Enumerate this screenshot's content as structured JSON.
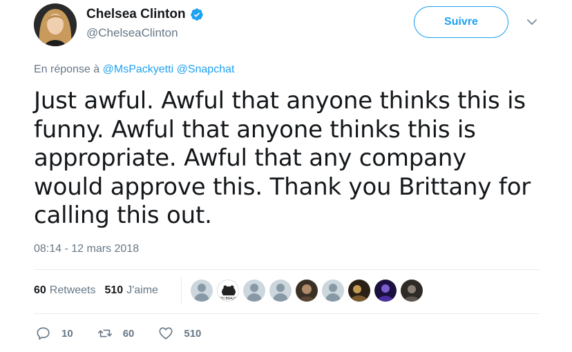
{
  "author": {
    "name": "Chelsea Clinton",
    "handle": "@ChelseaClinton",
    "verified": true,
    "avatar_icon": "profile-photo"
  },
  "header": {
    "follow_label": "Suivre",
    "more_icon": "chevron-down-icon"
  },
  "reply": {
    "prefix": "En réponse à",
    "mentions": [
      "@MsPackyetti",
      "@Snapchat"
    ]
  },
  "tweet": {
    "text": "Just awful. Awful that anyone thinks this is funny. Awful that anyone thinks this is appropriate. Awful that any company would approve this. Thank you Brittany for calling this out.",
    "timestamp": "08:14 - 12 mars 2018"
  },
  "stats": {
    "retweets_count": "60",
    "retweets_label": "Retweets",
    "likes_count": "510",
    "likes_label": "J'aime"
  },
  "liker_avatars": [
    "default",
    "idibrau-logo",
    "default",
    "default",
    "photo-dark",
    "default",
    "photo-warm",
    "photo-purple",
    "photo-grey"
  ],
  "liker_logo_text": "IDI BRAUN",
  "actions": {
    "reply_count": "10",
    "retweet_count": "60",
    "like_count": "510"
  },
  "colors": {
    "accent": "#1da1f2",
    "muted": "#657786",
    "text": "#14171a",
    "divider": "#e6ecf0"
  }
}
